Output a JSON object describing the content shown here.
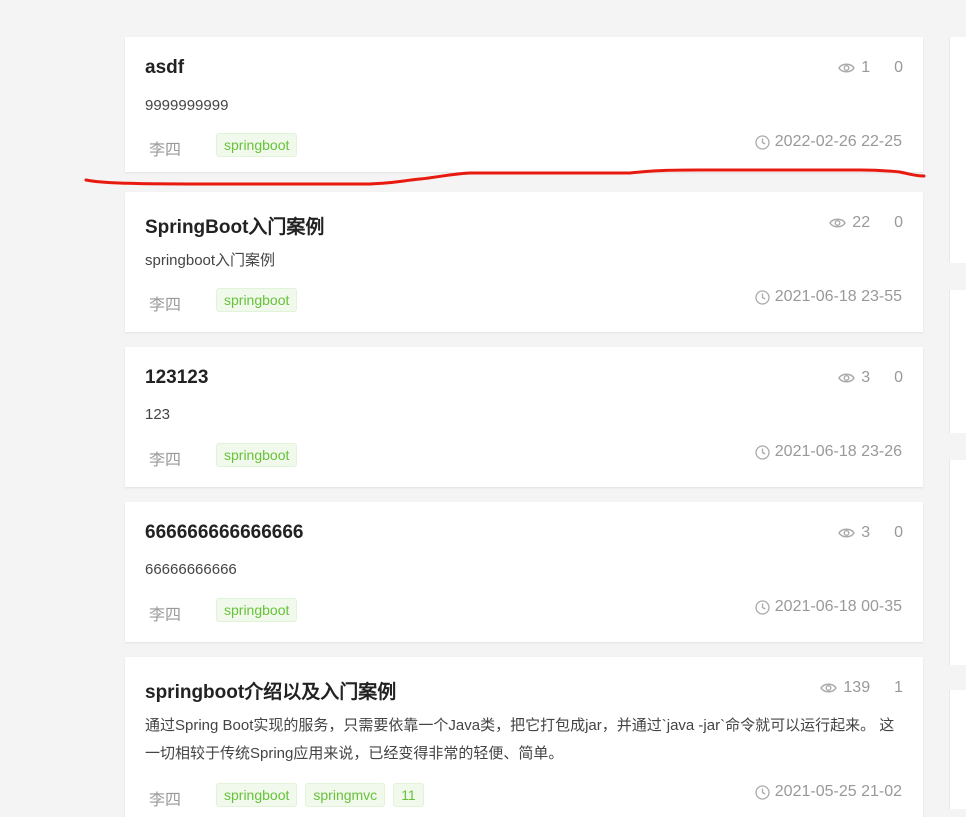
{
  "posts": [
    {
      "title": "asdf",
      "summary": "9999999999",
      "views": "1",
      "comments": "0",
      "author": "李四",
      "tags": [
        "springboot"
      ],
      "date": "2022-02-26 22-25"
    },
    {
      "title": "SpringBoot入门案例",
      "summary": "springboot入门案例",
      "views": "22",
      "comments": "0",
      "author": "李四",
      "tags": [
        "springboot"
      ],
      "date": "2021-06-18 23-55"
    },
    {
      "title": "123123",
      "summary": "123",
      "views": "3",
      "comments": "0",
      "author": "李四",
      "tags": [
        "springboot"
      ],
      "date": "2021-06-18 23-26"
    },
    {
      "title": "666666666666666",
      "summary": "66666666666",
      "views": "3",
      "comments": "0",
      "author": "李四",
      "tags": [
        "springboot"
      ],
      "date": "2021-06-18 00-35"
    },
    {
      "title": "springboot介绍以及入门案例",
      "summary": "通过Spring Boot实现的服务，只需要依靠一个Java类，把它打包成jar，并通过`java -jar`命令就可以运行起来。 这一切相较于传统Spring应用来说，已经变得非常的轻便、简单。",
      "views": "139",
      "comments": "1",
      "author": "李四",
      "tags": [
        "springboot",
        "springmvc",
        "11"
      ],
      "date": "2021-05-25 21-02"
    }
  ],
  "icons": {
    "views": "eye-icon",
    "date": "clock-icon"
  },
  "colors": {
    "tag_text": "#67c23a",
    "tag_bg": "#f0f9eb",
    "annotation_stroke": "#e8190f"
  }
}
